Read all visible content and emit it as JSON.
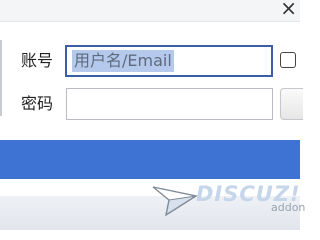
{
  "login": {
    "account_label": "账号",
    "account_placeholder": "用户名/Email",
    "password_label": "密码"
  },
  "branding": {
    "logo_text": "DISCUZ!",
    "logo_sub": "addon"
  },
  "colors": {
    "band_blue": "#3e73d3",
    "field_focus_border": "#3b5fa6",
    "selection_highlight": "#b5c9ec",
    "logo_text": "#c5d5ea"
  },
  "icons": {
    "close": "close-icon",
    "logo_glyph": "paper-plane-icon"
  }
}
